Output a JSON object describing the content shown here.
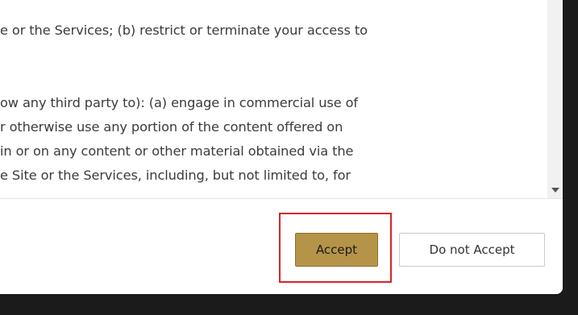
{
  "terms": {
    "lines": [
      "e or the Services; (b) restrict or terminate your access to",
      "",
      "ow any third party to): (a) engage in commercial use of",
      "r otherwise use any portion of the content offered on",
      "in or on any content or other material obtained via the",
      "e Site or the Services, including, but not limited to, for"
    ]
  },
  "buttons": {
    "accept_label": "Accept",
    "decline_label": "Do not Accept"
  },
  "icons": {
    "scroll_down": "triangle-down"
  },
  "colors": {
    "accept_bg": "#b59449",
    "highlight_border": "#d9232a",
    "backdrop": "#1b1b1b"
  }
}
